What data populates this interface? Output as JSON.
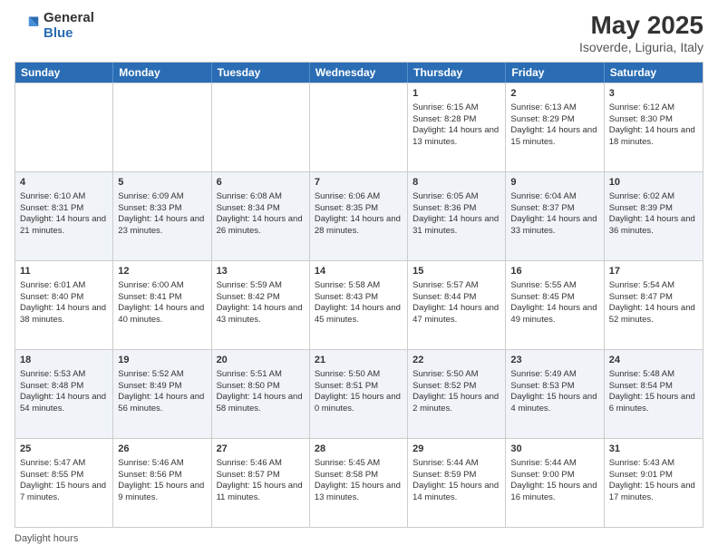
{
  "header": {
    "logo_general": "General",
    "logo_blue": "Blue",
    "title": "May 2025",
    "location": "Isoverde, Liguria, Italy"
  },
  "days_of_week": [
    "Sunday",
    "Monday",
    "Tuesday",
    "Wednesday",
    "Thursday",
    "Friday",
    "Saturday"
  ],
  "weeks": [
    [
      {
        "day": "",
        "sunrise": "",
        "sunset": "",
        "daylight": ""
      },
      {
        "day": "",
        "sunrise": "",
        "sunset": "",
        "daylight": ""
      },
      {
        "day": "",
        "sunrise": "",
        "sunset": "",
        "daylight": ""
      },
      {
        "day": "",
        "sunrise": "",
        "sunset": "",
        "daylight": ""
      },
      {
        "day": "1",
        "sunrise": "Sunrise: 6:15 AM",
        "sunset": "Sunset: 8:28 PM",
        "daylight": "Daylight: 14 hours and 13 minutes."
      },
      {
        "day": "2",
        "sunrise": "Sunrise: 6:13 AM",
        "sunset": "Sunset: 8:29 PM",
        "daylight": "Daylight: 14 hours and 15 minutes."
      },
      {
        "day": "3",
        "sunrise": "Sunrise: 6:12 AM",
        "sunset": "Sunset: 8:30 PM",
        "daylight": "Daylight: 14 hours and 18 minutes."
      }
    ],
    [
      {
        "day": "4",
        "sunrise": "Sunrise: 6:10 AM",
        "sunset": "Sunset: 8:31 PM",
        "daylight": "Daylight: 14 hours and 21 minutes."
      },
      {
        "day": "5",
        "sunrise": "Sunrise: 6:09 AM",
        "sunset": "Sunset: 8:33 PM",
        "daylight": "Daylight: 14 hours and 23 minutes."
      },
      {
        "day": "6",
        "sunrise": "Sunrise: 6:08 AM",
        "sunset": "Sunset: 8:34 PM",
        "daylight": "Daylight: 14 hours and 26 minutes."
      },
      {
        "day": "7",
        "sunrise": "Sunrise: 6:06 AM",
        "sunset": "Sunset: 8:35 PM",
        "daylight": "Daylight: 14 hours and 28 minutes."
      },
      {
        "day": "8",
        "sunrise": "Sunrise: 6:05 AM",
        "sunset": "Sunset: 8:36 PM",
        "daylight": "Daylight: 14 hours and 31 minutes."
      },
      {
        "day": "9",
        "sunrise": "Sunrise: 6:04 AM",
        "sunset": "Sunset: 8:37 PM",
        "daylight": "Daylight: 14 hours and 33 minutes."
      },
      {
        "day": "10",
        "sunrise": "Sunrise: 6:02 AM",
        "sunset": "Sunset: 8:39 PM",
        "daylight": "Daylight: 14 hours and 36 minutes."
      }
    ],
    [
      {
        "day": "11",
        "sunrise": "Sunrise: 6:01 AM",
        "sunset": "Sunset: 8:40 PM",
        "daylight": "Daylight: 14 hours and 38 minutes."
      },
      {
        "day": "12",
        "sunrise": "Sunrise: 6:00 AM",
        "sunset": "Sunset: 8:41 PM",
        "daylight": "Daylight: 14 hours and 40 minutes."
      },
      {
        "day": "13",
        "sunrise": "Sunrise: 5:59 AM",
        "sunset": "Sunset: 8:42 PM",
        "daylight": "Daylight: 14 hours and 43 minutes."
      },
      {
        "day": "14",
        "sunrise": "Sunrise: 5:58 AM",
        "sunset": "Sunset: 8:43 PM",
        "daylight": "Daylight: 14 hours and 45 minutes."
      },
      {
        "day": "15",
        "sunrise": "Sunrise: 5:57 AM",
        "sunset": "Sunset: 8:44 PM",
        "daylight": "Daylight: 14 hours and 47 minutes."
      },
      {
        "day": "16",
        "sunrise": "Sunrise: 5:55 AM",
        "sunset": "Sunset: 8:45 PM",
        "daylight": "Daylight: 14 hours and 49 minutes."
      },
      {
        "day": "17",
        "sunrise": "Sunrise: 5:54 AM",
        "sunset": "Sunset: 8:47 PM",
        "daylight": "Daylight: 14 hours and 52 minutes."
      }
    ],
    [
      {
        "day": "18",
        "sunrise": "Sunrise: 5:53 AM",
        "sunset": "Sunset: 8:48 PM",
        "daylight": "Daylight: 14 hours and 54 minutes."
      },
      {
        "day": "19",
        "sunrise": "Sunrise: 5:52 AM",
        "sunset": "Sunset: 8:49 PM",
        "daylight": "Daylight: 14 hours and 56 minutes."
      },
      {
        "day": "20",
        "sunrise": "Sunrise: 5:51 AM",
        "sunset": "Sunset: 8:50 PM",
        "daylight": "Daylight: 14 hours and 58 minutes."
      },
      {
        "day": "21",
        "sunrise": "Sunrise: 5:50 AM",
        "sunset": "Sunset: 8:51 PM",
        "daylight": "Daylight: 15 hours and 0 minutes."
      },
      {
        "day": "22",
        "sunrise": "Sunrise: 5:50 AM",
        "sunset": "Sunset: 8:52 PM",
        "daylight": "Daylight: 15 hours and 2 minutes."
      },
      {
        "day": "23",
        "sunrise": "Sunrise: 5:49 AM",
        "sunset": "Sunset: 8:53 PM",
        "daylight": "Daylight: 15 hours and 4 minutes."
      },
      {
        "day": "24",
        "sunrise": "Sunrise: 5:48 AM",
        "sunset": "Sunset: 8:54 PM",
        "daylight": "Daylight: 15 hours and 6 minutes."
      }
    ],
    [
      {
        "day": "25",
        "sunrise": "Sunrise: 5:47 AM",
        "sunset": "Sunset: 8:55 PM",
        "daylight": "Daylight: 15 hours and 7 minutes."
      },
      {
        "day": "26",
        "sunrise": "Sunrise: 5:46 AM",
        "sunset": "Sunset: 8:56 PM",
        "daylight": "Daylight: 15 hours and 9 minutes."
      },
      {
        "day": "27",
        "sunrise": "Sunrise: 5:46 AM",
        "sunset": "Sunset: 8:57 PM",
        "daylight": "Daylight: 15 hours and 11 minutes."
      },
      {
        "day": "28",
        "sunrise": "Sunrise: 5:45 AM",
        "sunset": "Sunset: 8:58 PM",
        "daylight": "Daylight: 15 hours and 13 minutes."
      },
      {
        "day": "29",
        "sunrise": "Sunrise: 5:44 AM",
        "sunset": "Sunset: 8:59 PM",
        "daylight": "Daylight: 15 hours and 14 minutes."
      },
      {
        "day": "30",
        "sunrise": "Sunrise: 5:44 AM",
        "sunset": "Sunset: 9:00 PM",
        "daylight": "Daylight: 15 hours and 16 minutes."
      },
      {
        "day": "31",
        "sunrise": "Sunrise: 5:43 AM",
        "sunset": "Sunset: 9:01 PM",
        "daylight": "Daylight: 15 hours and 17 minutes."
      }
    ]
  ],
  "footer": "Daylight hours"
}
